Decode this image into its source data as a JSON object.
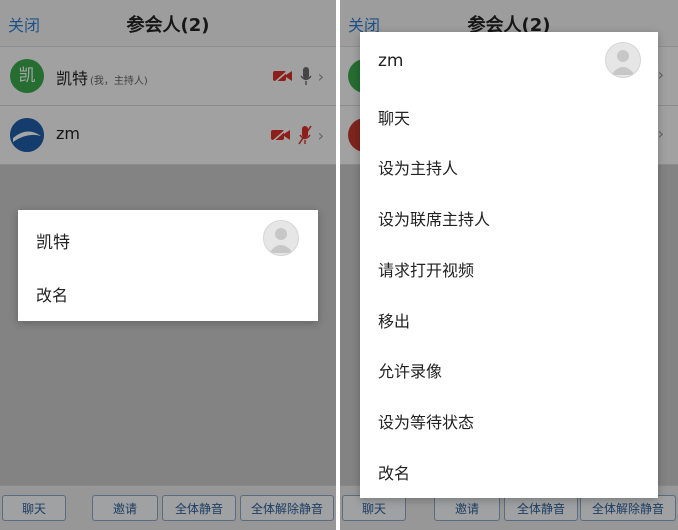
{
  "left": {
    "header": {
      "close_label": "关闭",
      "title": "参会人(2)"
    },
    "participants": [
      {
        "avatar_text": "凯",
        "name": "凯特",
        "note": "(我，主持人)"
      },
      {
        "avatar_text": "",
        "name": "zm",
        "note": ""
      }
    ],
    "bottom_bar": {
      "chat": "聊天",
      "invite": "邀请",
      "mute_all": "全体静音",
      "unmute_all": "全体解除静音"
    },
    "dialog": {
      "name": "凯特",
      "items": [
        "改名"
      ]
    }
  },
  "right": {
    "header": {
      "close_label": "关闭",
      "title": "参会人(2)"
    },
    "bottom_bar": {
      "chat": "聊天",
      "invite": "邀请",
      "mute_all": "全体静音",
      "unmute_all": "全体解除静音"
    },
    "dialog": {
      "name": "zm",
      "items": [
        "聊天",
        "设为主持人",
        "设为联席主持人",
        "请求打开视频",
        "移出",
        "允许录像",
        "设为等待状态",
        "改名"
      ]
    }
  },
  "colors": {
    "accent": "#2f7fd0",
    "muted_red": "#d9302a",
    "host_green": "#39a84a"
  },
  "icons": [
    "video-off-icon",
    "mic-icon",
    "mic-off-icon",
    "chevron-right-icon",
    "default-avatar-icon"
  ]
}
